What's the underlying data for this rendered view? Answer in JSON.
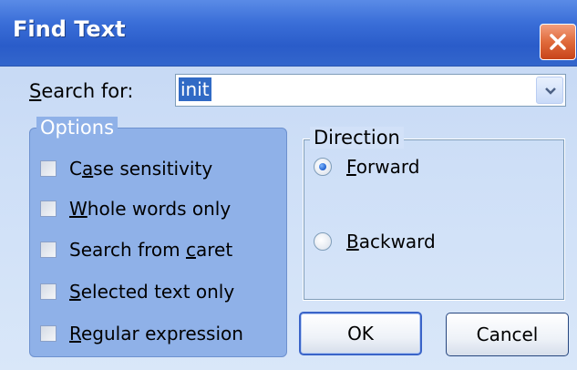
{
  "window": {
    "title": "Find Text"
  },
  "search": {
    "label_prefix": "",
    "label_mnemonic": "S",
    "label_rest": "earch for:",
    "value": "init"
  },
  "options": {
    "legend": "Options",
    "items": [
      {
        "pre": "C",
        "mnemonic": "a",
        "post": "se sensitivity",
        "checked": false
      },
      {
        "pre": "",
        "mnemonic": "W",
        "post": "hole words only",
        "checked": false
      },
      {
        "pre": "Search from ",
        "mnemonic": "c",
        "post": "aret",
        "checked": false
      },
      {
        "pre": "",
        "mnemonic": "S",
        "post": "elected text only",
        "checked": false
      },
      {
        "pre": "",
        "mnemonic": "R",
        "post": "egular expression",
        "checked": false
      }
    ]
  },
  "direction": {
    "legend": "Direction",
    "forward": {
      "pre": "",
      "mnemonic": "F",
      "post": "orward",
      "selected": true
    },
    "backward": {
      "pre": "",
      "mnemonic": "B",
      "post": "ackward",
      "selected": false
    }
  },
  "buttons": {
    "ok": "OK",
    "cancel": "Cancel"
  },
  "colors": {
    "titlebar": "#3a6ed8",
    "close": "#e06a3b",
    "options_panel": "#8fb1e8",
    "dialog_bg": "#cedff7"
  },
  "icons": {
    "close": "close-icon",
    "dropdown": "chevron-down-icon"
  }
}
